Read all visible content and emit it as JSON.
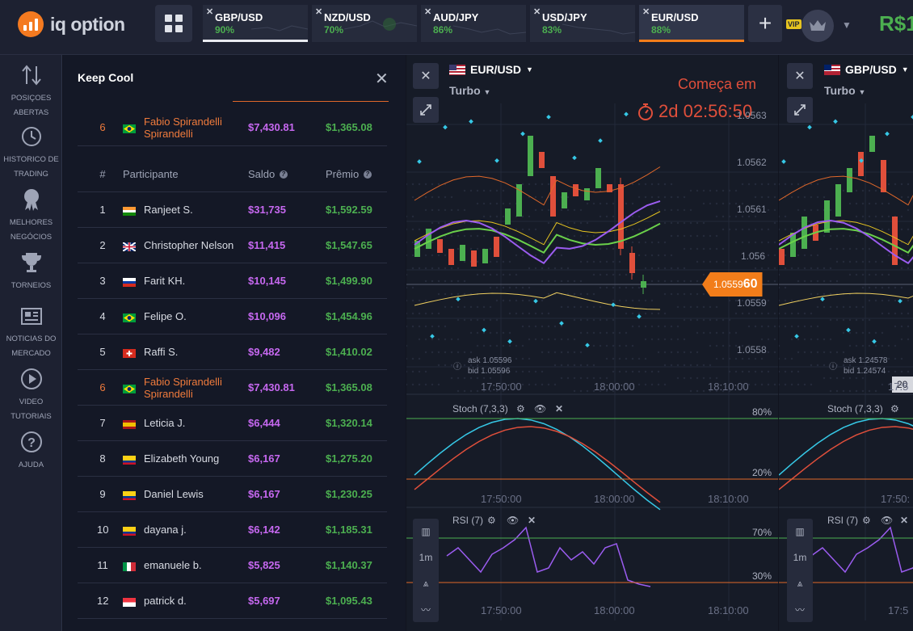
{
  "app": {
    "logo_text": "iq option"
  },
  "header": {
    "tabs": [
      {
        "name": "GBP/USD",
        "percent": "90%",
        "active": false
      },
      {
        "name": "NZD/USD",
        "percent": "70%",
        "active": false
      },
      {
        "name": "AUD/JPY",
        "percent": "86%",
        "active": false
      },
      {
        "name": "USD/JPY",
        "percent": "83%",
        "active": false
      },
      {
        "name": "EUR/USD",
        "percent": "88%",
        "active": true
      }
    ],
    "vip_label": "VIP",
    "balance": "R$1"
  },
  "sidebar": {
    "items": [
      {
        "label": "POSIÇOES ABERTAS",
        "icon": "arrows-updown-icon"
      },
      {
        "label": "HISTORICO DE TRADING",
        "icon": "history-icon"
      },
      {
        "label": "MELHORES NEGÓCIOS",
        "icon": "medal-icon"
      },
      {
        "label": "TORNEIOS",
        "icon": "trophy-icon"
      },
      {
        "label": "NOTICIAS DO MERCADO",
        "icon": "newspaper-icon"
      },
      {
        "label": "VIDEO TUTORIAIS",
        "icon": "play-icon"
      },
      {
        "label": "AJUDA",
        "icon": "help-icon"
      }
    ]
  },
  "tournament": {
    "title": "Keep Cool",
    "header": {
      "rank": "#",
      "participant": "Participante",
      "balance": "Saldo",
      "prize": "Prêmio"
    },
    "me": {
      "rank": "6",
      "name": "Fabio Spirandelli Spirandelli",
      "flag": "br",
      "balance": "$7,430.81",
      "prize": "$1,365.08"
    },
    "rows": [
      {
        "rank": "1",
        "name": "Ranjeet S.",
        "flag": "in",
        "balance": "$31,735",
        "prize": "$1,592.59"
      },
      {
        "rank": "2",
        "name": "Christopher Nelson",
        "flag": "gb",
        "balance": "$11,415",
        "prize": "$1,547.65"
      },
      {
        "rank": "3",
        "name": "Farit KH.",
        "flag": "ru",
        "balance": "$10,145",
        "prize": "$1,499.90"
      },
      {
        "rank": "4",
        "name": "Felipe O.",
        "flag": "br",
        "balance": "$10,096",
        "prize": "$1,454.96"
      },
      {
        "rank": "5",
        "name": "Raffi S.",
        "flag": "ch",
        "balance": "$9,482",
        "prize": "$1,410.02"
      },
      {
        "rank": "6",
        "name": "Fabio Spirandelli Spirandelli",
        "flag": "br",
        "balance": "$7,430.81",
        "prize": "$1,365.08"
      },
      {
        "rank": "7",
        "name": "Leticia J.",
        "flag": "es",
        "balance": "$6,444",
        "prize": "$1,320.14"
      },
      {
        "rank": "8",
        "name": "Elizabeth Young",
        "flag": "co",
        "balance": "$6,167",
        "prize": "$1,275.20"
      },
      {
        "rank": "9",
        "name": "Daniel Lewis",
        "flag": "co",
        "balance": "$6,167",
        "prize": "$1,230.25"
      },
      {
        "rank": "10",
        "name": "dayana j.",
        "flag": "co",
        "balance": "$6,142",
        "prize": "$1,185.31"
      },
      {
        "rank": "11",
        "name": "emanuele b.",
        "flag": "it",
        "balance": "$5,825",
        "prize": "$1,140.37"
      },
      {
        "rank": "12",
        "name": "patrick d.",
        "flag": "sg",
        "balance": "$5,697",
        "prize": "$1,095.43"
      }
    ]
  },
  "chart1": {
    "asset": "EUR/USD",
    "mode": "Turbo",
    "countdown_label": "Começa em",
    "countdown": "2d 02:56:50",
    "prices": [
      "1.0563",
      "1.0562",
      "1.0561",
      "1.056",
      "1.0559",
      "1.0558"
    ],
    "current_price_main": "1.0559",
    "current_price_tail": "60",
    "ask": "ask 1.05596",
    "bid": "bid 1.05596",
    "times": [
      "17:50:00",
      "18:00:00",
      "18:10:00"
    ],
    "stoch_label": "Stoch (7,3,3)",
    "stoch_levels": [
      "80%",
      "20%"
    ],
    "rsi_label": "RSI (7)",
    "rsi_levels": [
      "70%",
      "30%"
    ],
    "timeframe": "1m"
  },
  "chart2": {
    "asset": "GBP/USD",
    "mode": "Turbo",
    "ask": "ask 1.24578",
    "bid": "bid 1.24574",
    "price_tag": "20",
    "times": [
      "17:5",
      "17:50:",
      "17:5"
    ],
    "stoch_label": "Stoch (7,3,3)",
    "rsi_label": "RSI (7)",
    "timeframe": "1m"
  },
  "colors": {
    "accent": "#f27d1a",
    "green": "#4caf50",
    "red": "#e04f3b",
    "purple": "#c668f0",
    "panel": "#1d2131"
  }
}
